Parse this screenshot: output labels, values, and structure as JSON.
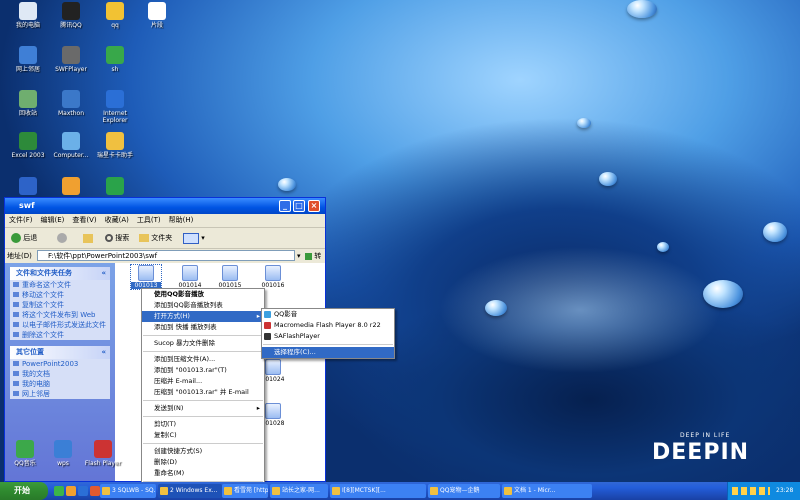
{
  "desktop_icons": [
    {
      "label": "我的电脑",
      "color": "#dfe9f5"
    },
    {
      "label": "腾讯QQ",
      "color": "#222222"
    },
    {
      "label": "qq",
      "color": "#f2c233"
    },
    {
      "label": "网上邻居",
      "color": "#3f7fd6"
    },
    {
      "label": "SWFPlayer",
      "color": "#6a6a6a"
    },
    {
      "label": "sh",
      "color": "#38a84a"
    },
    {
      "label": "回收站",
      "color": "#6fae6f"
    },
    {
      "label": "Maxthon",
      "color": "#3b78c9"
    },
    {
      "label": "Internet Explorer",
      "color": "#2b6fd6"
    },
    {
      "label": "Excel 2003",
      "color": "#2d8a3a"
    },
    {
      "label": "Computer...",
      "color": "#6bb0e8"
    },
    {
      "label": "瑞星卡卡助手",
      "color": "#f0c040"
    },
    {
      "label": "",
      "color": "#2d63c8"
    },
    {
      "label": "",
      "color": "#f0a030"
    },
    {
      "label": "",
      "color": "#2aa34a"
    },
    {
      "label": "片段",
      "color": "#ffffff"
    }
  ],
  "bottom_icons": [
    {
      "label": "QQ音乐",
      "color": "#3ca84a"
    },
    {
      "label": "wps",
      "color": "#3b7fd6"
    },
    {
      "label": "Flash Player",
      "color": "#c33"
    }
  ],
  "brand": {
    "text": "DEEPIN",
    "tag": "DEEP IN LIFE"
  },
  "window": {
    "title": "swf",
    "menu": [
      "文件(F)",
      "编辑(E)",
      "查看(V)",
      "收藏(A)",
      "工具(T)",
      "帮助(H)"
    ],
    "toolbar": {
      "back": "后退",
      "search": "搜索",
      "folders": "文件夹"
    },
    "address_label": "地址(D)",
    "address_value": "F:\\软件\\ppt\\PowerPoint2003\\swf",
    "go": "转到",
    "tasks": {
      "title": "文件和文件夹任务",
      "items": [
        "重命名这个文件",
        "移动这个文件",
        "复制这个文件",
        "将这个文件发布到 Web",
        "以电子邮件形式发送此文件",
        "删除这个文件"
      ]
    },
    "places": {
      "title": "其它位置",
      "items": [
        "PowerPoint2003",
        "我的文档",
        "我的电脑",
        "网上邻居"
      ]
    }
  },
  "files": [
    "001013",
    "001014",
    "001015",
    "001016",
    "001024",
    "001028"
  ],
  "context_menu": [
    {
      "label": "使用QQ影音播放",
      "bold": true
    },
    {
      "label": "添加到QQ影音播放列表"
    },
    {
      "label": "打开方式(H)",
      "sub": true,
      "selected": true
    },
    {
      "label": "添加到 快播 播放列表"
    },
    {
      "sep": true
    },
    {
      "label": "Sucop 暴力文件删除"
    },
    {
      "sep": true
    },
    {
      "label": "添加到压缩文件(A)..."
    },
    {
      "label": "添加到 \"001013.rar\"(T)"
    },
    {
      "label": "压缩并 E-mail..."
    },
    {
      "label": "压缩到 \"001013.rar\" 并 E-mail"
    },
    {
      "sep": true
    },
    {
      "label": "发送到(N)",
      "sub": true
    },
    {
      "sep": true
    },
    {
      "label": "剪切(T)"
    },
    {
      "label": "复制(C)"
    },
    {
      "sep": true
    },
    {
      "label": "创建快捷方式(S)"
    },
    {
      "label": "删除(D)"
    },
    {
      "label": "重命名(M)"
    },
    {
      "sep": true
    },
    {
      "label": "属性(R)"
    }
  ],
  "submenu": [
    {
      "label": "QQ影音",
      "color": "#3ca0e0"
    },
    {
      "label": "Macromedia Flash Player 8.0  r22",
      "color": "#c33"
    },
    {
      "label": "SAFlashPlayer",
      "color": "#333"
    },
    {
      "sep": true
    },
    {
      "label": "选择程序(C)...",
      "selected": true
    }
  ],
  "taskbar": {
    "start": "开始",
    "tasks": [
      {
        "label": "3 SQLWB - SQ..."
      },
      {
        "label": "2 Windows Ex...",
        "active": true
      },
      {
        "label": "看雪苑 [http..."
      },
      {
        "label": "站长之家-网..."
      },
      {
        "label": "I[8][MCTSK][..."
      },
      {
        "label": "QQ宠物—企鹅"
      },
      {
        "label": "文档 1 - Micr..."
      }
    ],
    "clock": "23:28"
  }
}
